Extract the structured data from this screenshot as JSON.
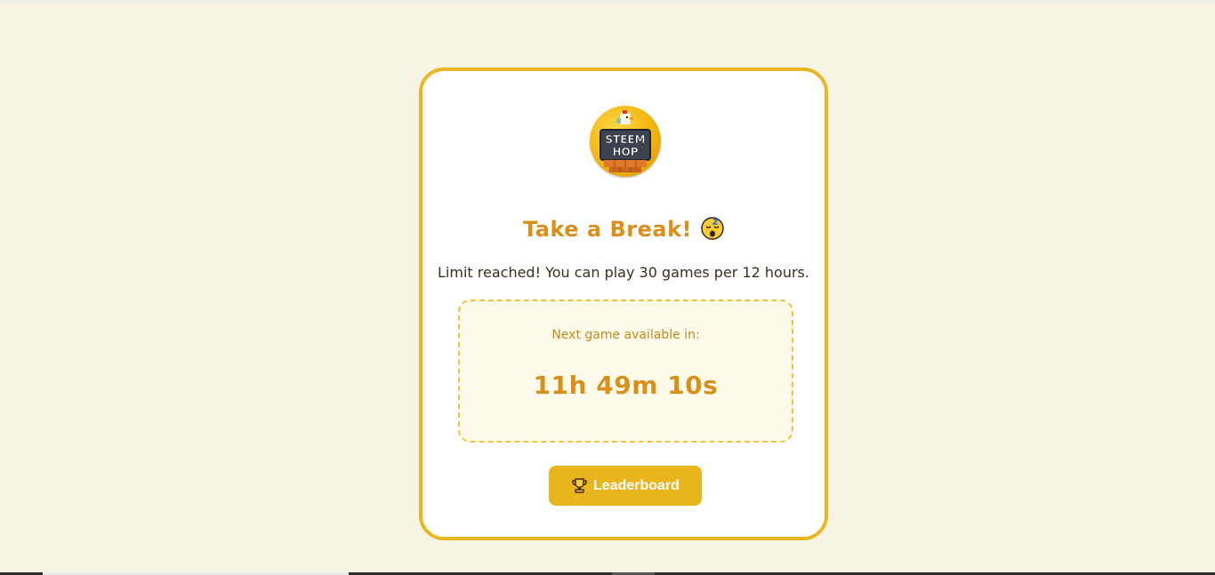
{
  "logo": {
    "text_line1": "STEEM",
    "text_line2": "HOP",
    "icon": "chicken-logo"
  },
  "title": {
    "text": "Take a Break!",
    "emoji_icon": "sleeping-face-icon"
  },
  "subtitle": "Limit reached! You can play 30 games per 12 hours.",
  "timer": {
    "label": "Next game available in:",
    "value": "11h 49m 10s"
  },
  "leaderboard_button": {
    "label": "Leaderboard",
    "icon": "trophy-icon"
  },
  "colors": {
    "accent": "#e9b722",
    "title": "#d8901b",
    "background": "#f8f4e4",
    "timer_bg": "#fffbea"
  }
}
